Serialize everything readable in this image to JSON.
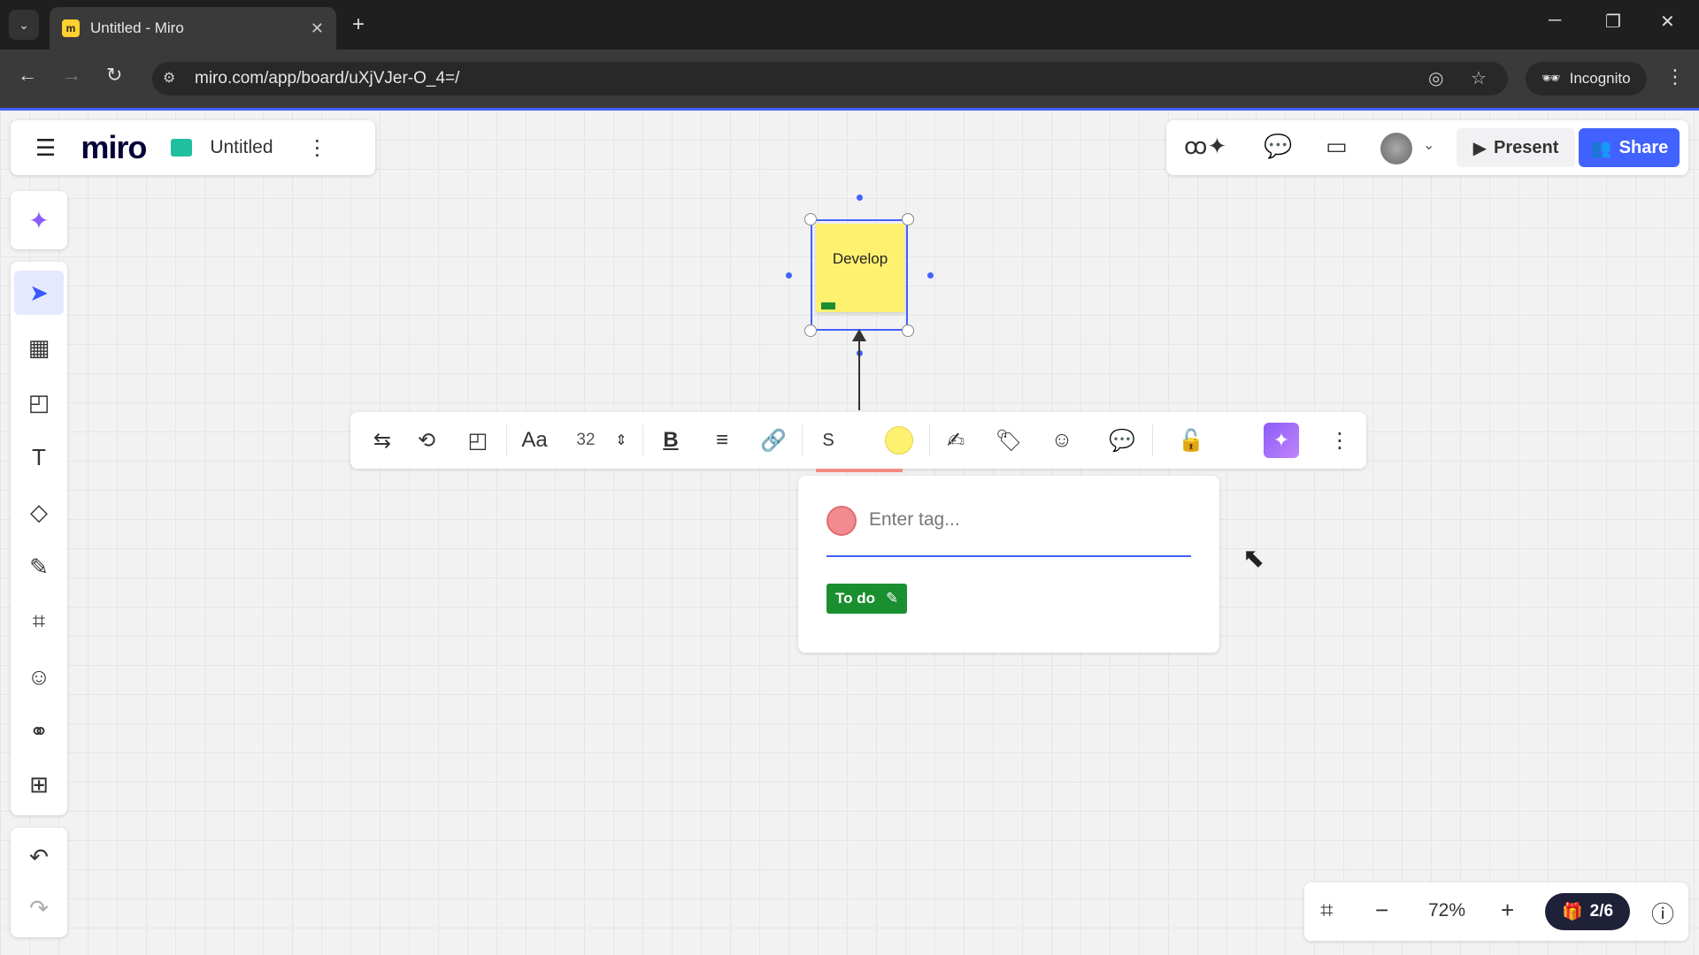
{
  "browser": {
    "tab_title": "Untitled - Miro",
    "favicon_text": "m",
    "url": "miro.com/app/board/uXjVJer-O_4=/",
    "incognito_label": "Incognito"
  },
  "board": {
    "logo": "miro",
    "name": "Untitled"
  },
  "header": {
    "present_label": "Present",
    "share_label": "Share"
  },
  "sticky": {
    "text": "Develop",
    "color": "#fef170"
  },
  "context_toolbar": {
    "font_size": "32",
    "stroke_label": "S"
  },
  "tag_popup": {
    "placeholder": "Enter tag...",
    "tag_color": "#f28b8f",
    "existing_tag": "To do",
    "existing_tag_color": "#1a8f2f"
  },
  "footer": {
    "zoom": "72%",
    "pages": "2/6"
  },
  "accent_color": "#4262ff"
}
